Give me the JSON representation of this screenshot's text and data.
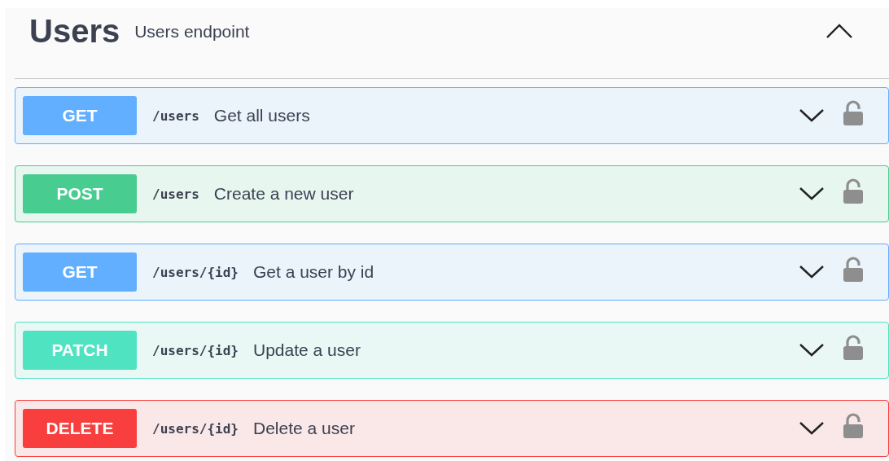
{
  "section": {
    "title": "Users",
    "description": "Users endpoint",
    "expanded": true
  },
  "operations": [
    {
      "method": "GET",
      "path": "/users",
      "summary": "Get all users",
      "expanded": false,
      "locked": false
    },
    {
      "method": "POST",
      "path": "/users",
      "summary": "Create a new user",
      "expanded": false,
      "locked": false
    },
    {
      "method": "GET",
      "path": "/users/{id}",
      "summary": "Get a user by id",
      "expanded": false,
      "locked": false
    },
    {
      "method": "PATCH",
      "path": "/users/{id}",
      "summary": "Update a user",
      "expanded": false,
      "locked": false
    },
    {
      "method": "DELETE",
      "path": "/users/{id}",
      "summary": "Delete a user",
      "expanded": false,
      "locked": false
    }
  ]
}
